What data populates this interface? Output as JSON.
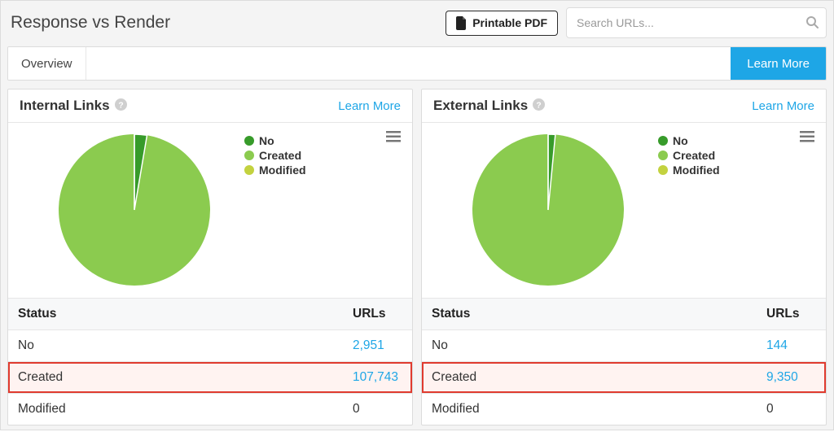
{
  "page": {
    "title": "Response vs Render",
    "pdf_button": "Printable PDF",
    "search_placeholder": "Search URLs...",
    "tabs": {
      "overview": "Overview",
      "learn_more": "Learn More"
    }
  },
  "panels": {
    "left": {
      "title": "Internal Links",
      "learn_more": "Learn More",
      "columns": {
        "status": "Status",
        "urls": "URLs"
      },
      "rows": [
        {
          "status": "No",
          "urls": "2,951",
          "link": true,
          "highlight": false
        },
        {
          "status": "Created",
          "urls": "107,743",
          "link": true,
          "highlight": true
        },
        {
          "status": "Modified",
          "urls": "0",
          "link": false,
          "highlight": false
        }
      ],
      "legend": [
        "No",
        "Created",
        "Modified"
      ]
    },
    "right": {
      "title": "External Links",
      "learn_more": "Learn More",
      "columns": {
        "status": "Status",
        "urls": "URLs"
      },
      "rows": [
        {
          "status": "No",
          "urls": "144",
          "link": true,
          "highlight": false
        },
        {
          "status": "Created",
          "urls": "9,350",
          "link": true,
          "highlight": true
        },
        {
          "status": "Modified",
          "urls": "0",
          "link": false,
          "highlight": false
        }
      ],
      "legend": [
        "No",
        "Created",
        "Modified"
      ]
    }
  },
  "chart_data": [
    {
      "type": "pie",
      "title": "Internal Links",
      "series": [
        {
          "name": "No",
          "value": 2951,
          "color": "#379b2a"
        },
        {
          "name": "Created",
          "value": 107743,
          "color": "#8bcb4f"
        },
        {
          "name": "Modified",
          "value": 0,
          "color": "#c3d23f"
        }
      ]
    },
    {
      "type": "pie",
      "title": "External Links",
      "series": [
        {
          "name": "No",
          "value": 144,
          "color": "#379b2a"
        },
        {
          "name": "Created",
          "value": 9350,
          "color": "#8bcb4f"
        },
        {
          "name": "Modified",
          "value": 0,
          "color": "#c3d23f"
        }
      ]
    }
  ]
}
